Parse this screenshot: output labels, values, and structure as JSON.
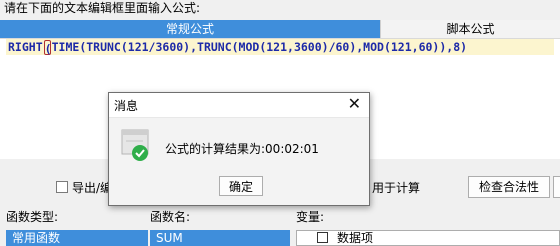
{
  "prompt": "请在下面的文本编辑框里面输入公式:",
  "tabs": {
    "active": "常规公式",
    "inactive": "脚本公式"
  },
  "editor": {
    "formula_prefix": "RIGHT",
    "formula_rest": "TIME(TRUNC(121/3600),TRUNC(MOD(121,3600)/60),MOD(121,60)),8)"
  },
  "options": {
    "export_label": "导出/编",
    "calc_label": "用于计算",
    "check_button": "检查合法性"
  },
  "lower": {
    "func_type_label": "函数类型:",
    "func_name_label": "函数名:",
    "var_label": "变量:",
    "func_type_selected": "常用函数",
    "func_name_selected": "SUM",
    "var_item": "数据项"
  },
  "dialog": {
    "title": "消息",
    "message": "公式的计算结果为:00:02:01",
    "ok": "确定"
  }
}
